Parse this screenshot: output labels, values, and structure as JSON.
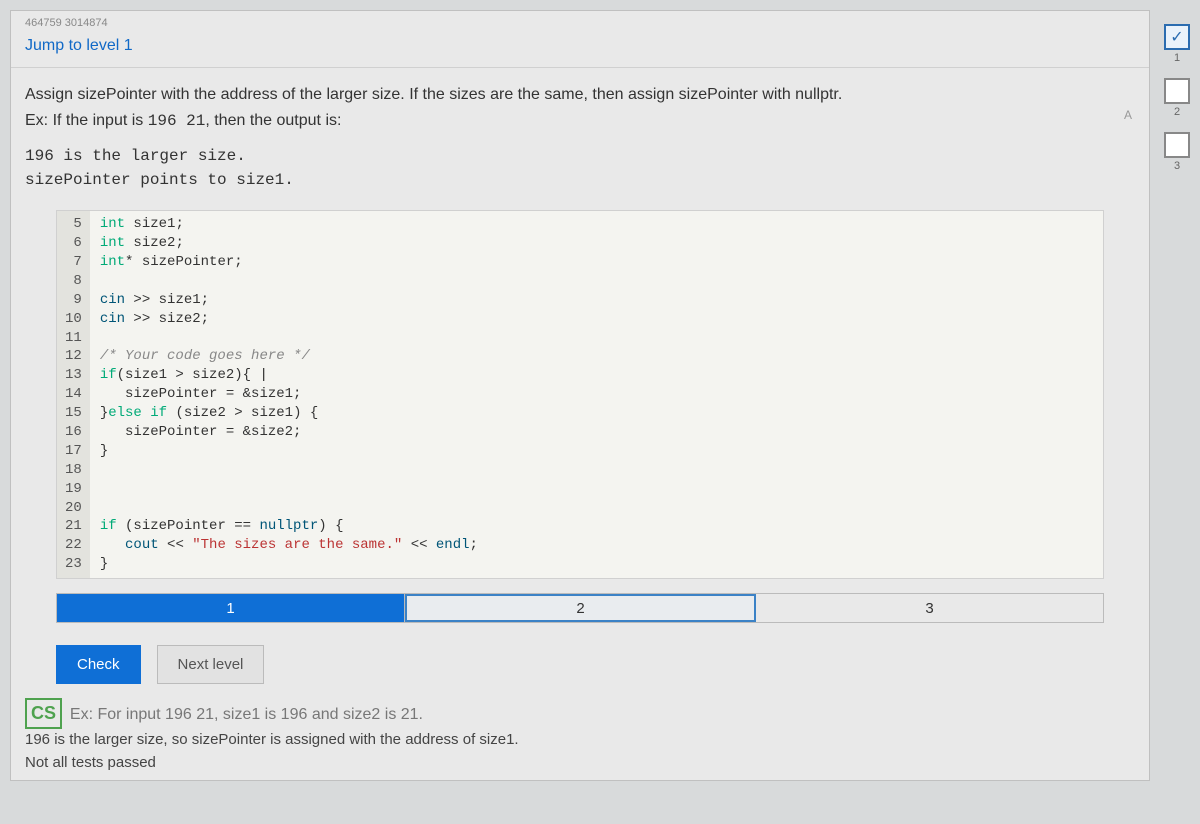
{
  "top_id": "464759 3014874",
  "jump_link": "Jump to level 1",
  "prompt": {
    "line1": "Assign sizePointer with the address of the larger size. If the sizes are the same, then assign sizePointer with nullptr.",
    "ex_prefix": "Ex: If the input is ",
    "ex_input": "196  21",
    "ex_suffix": ", then the output is:"
  },
  "output": {
    "line1": "196 is the larger size.",
    "line2": "sizePointer points to size1."
  },
  "code": {
    "lines": [
      {
        "n": 5,
        "text": "int size1;"
      },
      {
        "n": 6,
        "text": "int size2;"
      },
      {
        "n": 7,
        "text": "int* sizePointer;"
      },
      {
        "n": 8,
        "text": ""
      },
      {
        "n": 9,
        "text": "cin >> size1;"
      },
      {
        "n": 10,
        "text": "cin >> size2;"
      },
      {
        "n": 11,
        "text": ""
      },
      {
        "n": 12,
        "text": "/* Your code goes here */"
      },
      {
        "n": 13,
        "text": "if(size1 > size2){"
      },
      {
        "n": 14,
        "text": "   sizePointer = &size1;"
      },
      {
        "n": 15,
        "text": "}else if (size2 > size1) {"
      },
      {
        "n": 16,
        "text": "   sizePointer = &size2;"
      },
      {
        "n": 17,
        "text": "}"
      },
      {
        "n": 18,
        "text": ""
      },
      {
        "n": 19,
        "text": ""
      },
      {
        "n": 20,
        "text": ""
      },
      {
        "n": 21,
        "text": "if (sizePointer == nullptr) {"
      },
      {
        "n": 22,
        "text": "   cout << \"The sizes are the same.\" << endl;"
      },
      {
        "n": 23,
        "text": "}"
      }
    ]
  },
  "steps": {
    "items": [
      "1",
      "2",
      "3"
    ],
    "active": 0,
    "current": 1
  },
  "buttons": {
    "check": "Check",
    "next": "Next level"
  },
  "hint": {
    "cs": "CS",
    "title_partial": "Ex: For input 196 21, size1 is 196 and size2 is 21.",
    "explain": "196 is the larger size, so sizePointer is assigned with the address of size1.",
    "not_all": "Not all tests passed"
  },
  "side": [
    {
      "icon": "✓",
      "num": "1",
      "done": true
    },
    {
      "icon": "",
      "num": "2",
      "done": false
    },
    {
      "icon": "",
      "num": "3",
      "done": false
    }
  ]
}
